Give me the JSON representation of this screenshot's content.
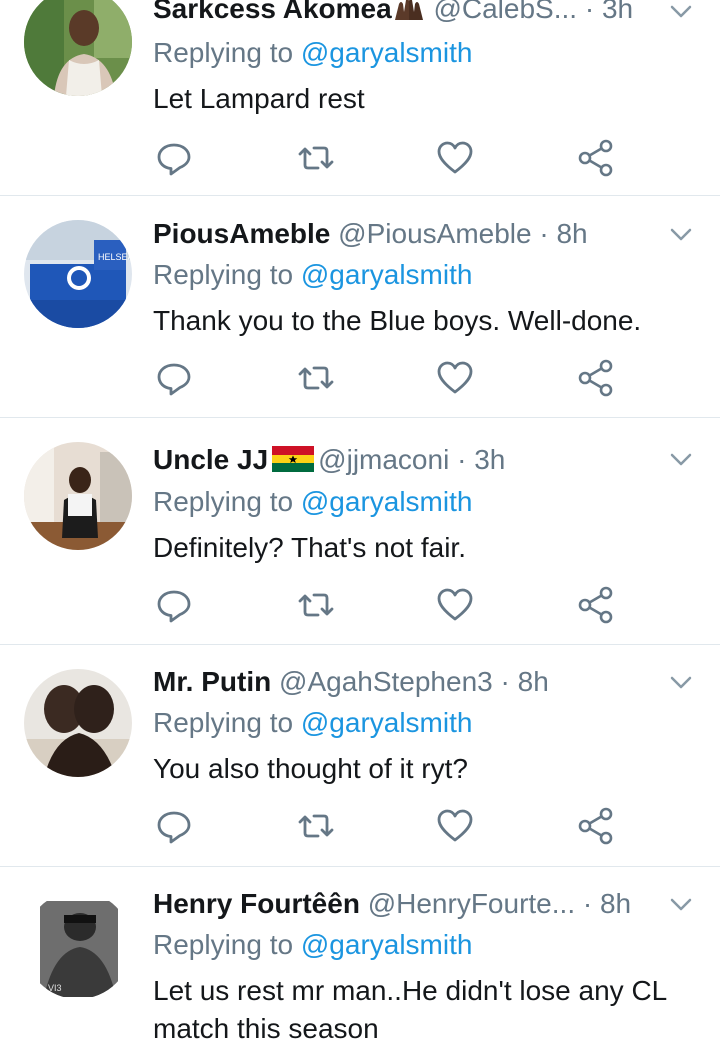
{
  "tweets": [
    {
      "name": "Sarkcess Akomea",
      "handle": "@CalebS...",
      "dot": " · ",
      "time": "3h",
      "replying_prefix": "Replying to ",
      "replying_to": "@garyalsmith",
      "text": "Let Lampard rest"
    },
    {
      "name": "PiousAmeble",
      "handle": "@PiousAmeble",
      "dot": " · ",
      "time": "8h",
      "replying_prefix": "Replying to ",
      "replying_to": "@garyalsmith",
      "text": "Thank you to the Blue boys. Well-done."
    },
    {
      "name": "Uncle JJ",
      "handle": "@jjmaconi",
      "dot": " · ",
      "time": "3h",
      "replying_prefix": "Replying to ",
      "replying_to": "@garyalsmith",
      "text": "Definitely? That's not fair."
    },
    {
      "name": "Mr. Putin",
      "handle": "@AgahStephen3",
      "dot": " · ",
      "time": "8h",
      "replying_prefix": "Replying to ",
      "replying_to": "@garyalsmith",
      "text": "You also thought of it ryt?"
    },
    {
      "name": "Henry Fourtêên",
      "handle": "@HenryFourte...",
      "dot": " · ",
      "time": "8h",
      "replying_prefix": "Replying to ",
      "replying_to": "@garyalsmith",
      "text": "Let us rest mr man..He didn't lose any CL match this season"
    }
  ],
  "icons": {
    "reply": "reply-icon",
    "retweet": "retweet-icon",
    "like": "like-icon",
    "share": "share-icon",
    "menu": "chevron-down-icon"
  },
  "colors": {
    "name": "#14171a",
    "meta": "#657786",
    "mention": "#1b95e0",
    "divider": "#e1e8ed"
  }
}
